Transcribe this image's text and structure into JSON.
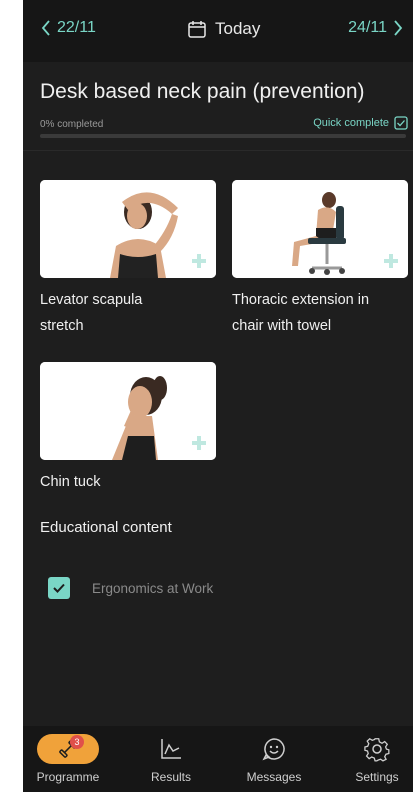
{
  "nav": {
    "prev": "22/11",
    "today": "Today",
    "next": "24/11"
  },
  "programme": {
    "title": "Desk based neck pain (prevention)",
    "progress_text": "0% completed",
    "progress_fraction": 0.0,
    "quick_complete": "Quick complete"
  },
  "exercises": [
    {
      "label_line1": "Levator scapula",
      "label_line2": "stretch"
    },
    {
      "label_line1": "Thoracic extension in",
      "label_line2": "chair with towel"
    },
    {
      "label_line1": "Chin  tuck",
      "label_line2": ""
    }
  ],
  "education": {
    "heading": "Educational content",
    "items": [
      {
        "label": "Ergonomics at Work",
        "checked": true
      }
    ]
  },
  "tabs": [
    {
      "label": "Programme",
      "icon": "dumbbell-icon",
      "badge": "3",
      "active": true
    },
    {
      "label": "Results",
      "icon": "chart-line-icon"
    },
    {
      "label": "Messages",
      "icon": "smiley-chat-icon"
    },
    {
      "label": "Settings",
      "icon": "gear-icon"
    }
  ],
  "colors": {
    "accent": "#7ad6c6",
    "active_tab": "#f0a23a",
    "badge": "#e0504a",
    "background": "#1e1e1e"
  }
}
